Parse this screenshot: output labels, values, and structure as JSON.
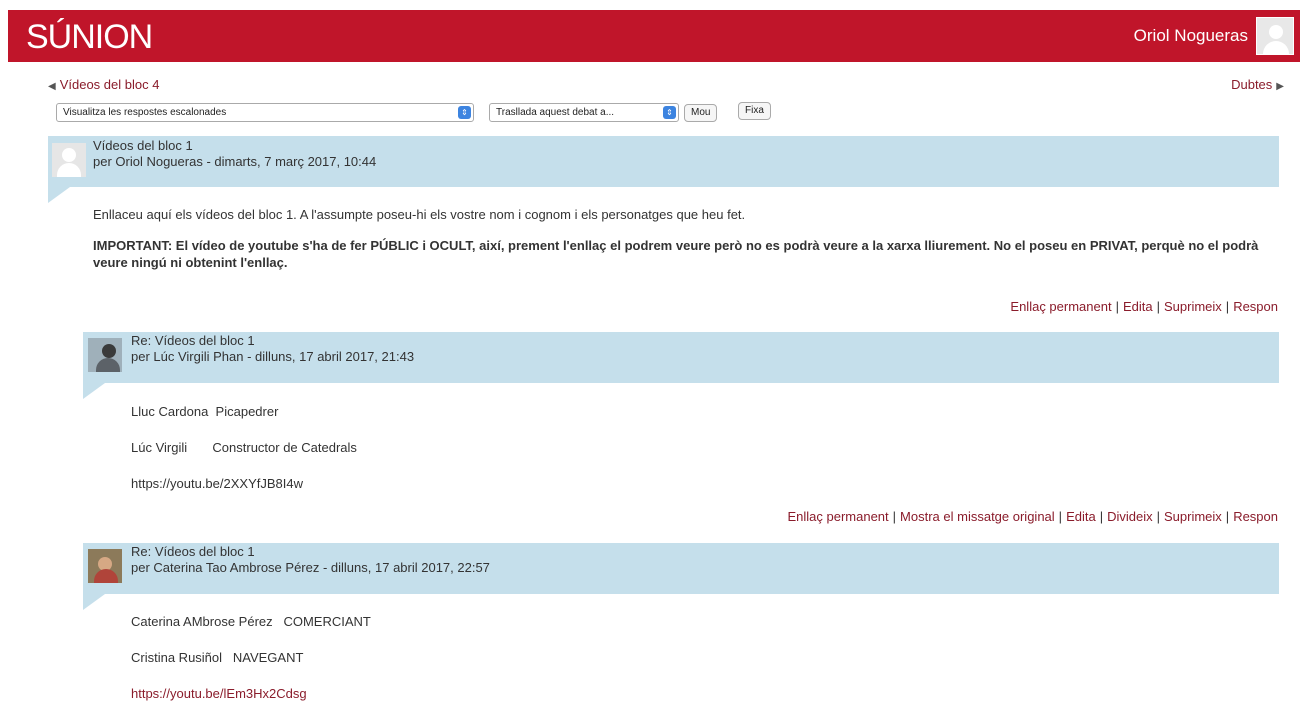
{
  "header": {
    "logo": "SÚNION",
    "user_name": "Oriol Nogueras"
  },
  "nav": {
    "prev_label": "Vídeos del bloc 4",
    "next_label": "Dubtes"
  },
  "controls": {
    "display_mode": "Visualitza les respostes escalonades",
    "move_select": "Trasllada aquest debat a...",
    "move_button": "Mou",
    "pin_button": "Fixa"
  },
  "posts": [
    {
      "title": "Vídeos del bloc 1",
      "meta": "per Oriol Nogueras - dimarts, 7 març 2017, 10:44",
      "body": [
        "Enllaceu aquí els vídeos del bloc 1. A l'assumpte poseu-hi els vostre nom i cognom i els personatges que heu fet.",
        "IMPORTANT: El vídeo de youtube s'ha de fer PÚBLIC i OCULT, així, prement l'enllaç el podrem veure però no es podrà veure a la xarxa lliurement. No el poseu en PRIVAT, perquè no el podrà veure ningú ni obtenint l'enllaç."
      ],
      "actions": [
        "Enllaç permanent",
        "Edita",
        "Suprimeix",
        "Respon"
      ]
    },
    {
      "title": "Re: Vídeos del bloc 1",
      "meta": "per Lúc Virgili Phan - dilluns, 17 abril 2017, 21:43",
      "body": [
        "Lluc Cardona  Picapedrer",
        "Lúc Virgili       Constructor de Catedrals",
        "https://youtu.be/2XXYfJB8I4w"
      ],
      "actions": [
        "Enllaç permanent",
        "Mostra el missatge original",
        "Edita",
        "Divideix",
        "Suprimeix",
        "Respon"
      ]
    },
    {
      "title": "Re: Vídeos del bloc 1",
      "meta": "per Caterina Tao Ambrose Pérez - dilluns, 17 abril 2017, 22:57",
      "body": [
        "Caterina AMbrose Pérez   COMERCIANT",
        "Cristina Rusiñol   NAVEGANT",
        "https://youtu.be/lEm3Hx2Cdsg"
      ]
    }
  ],
  "colors": {
    "brand": "#c0152a",
    "link": "#8a1c2b",
    "post_header": "#c5dfeb"
  }
}
